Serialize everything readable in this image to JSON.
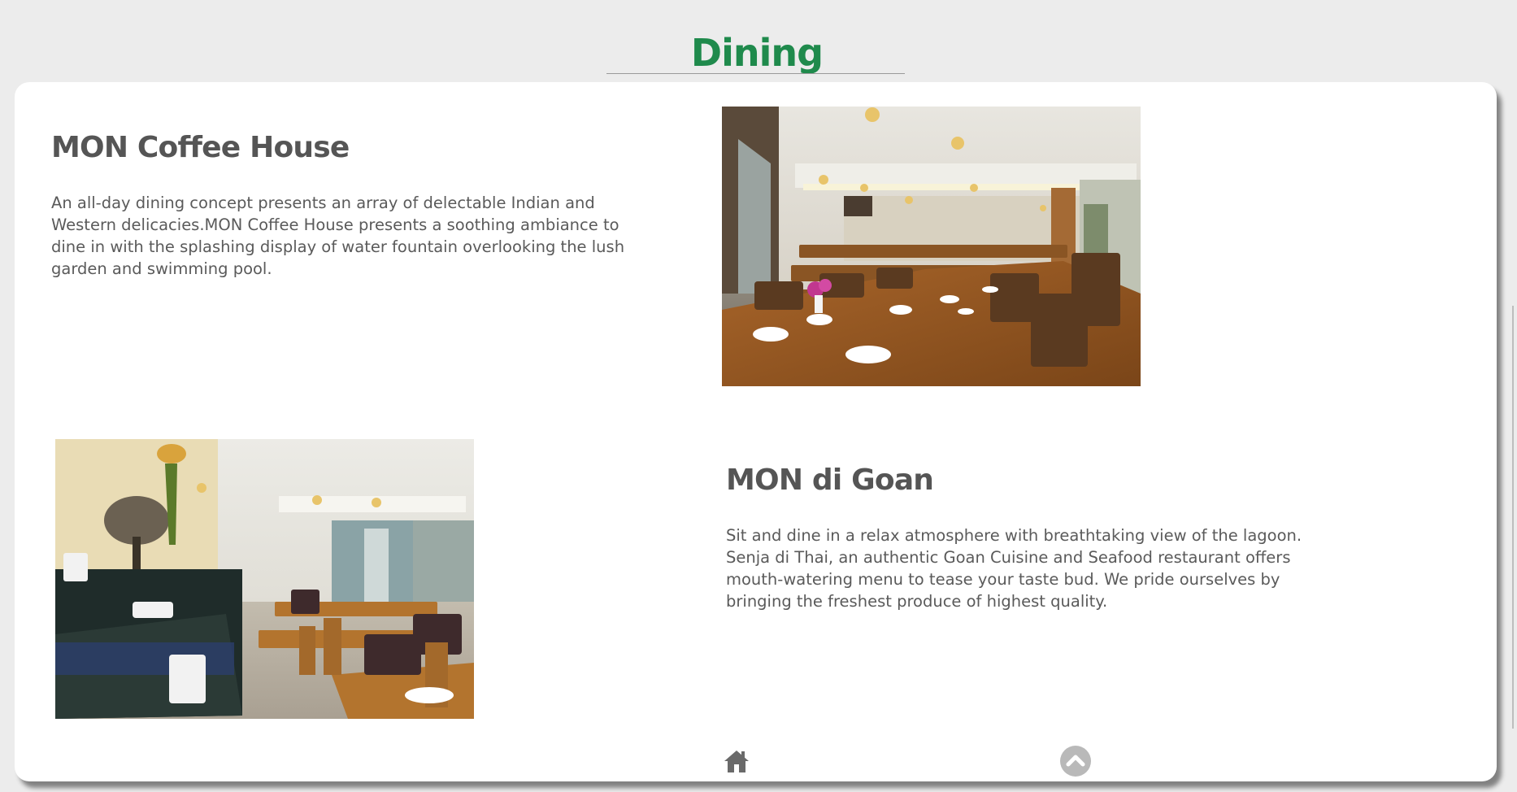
{
  "header": {
    "title": "Dining"
  },
  "sections": [
    {
      "heading": "MON Coffee House",
      "description": "An all-day dining concept presents an array of delectable Indian and Western delicacies.MON Coffee House presents a soothing ambiance to dine in with the splashing display of water fountain overlooking the lush garden and swimming pool.",
      "image": "restaurant-dining-hall-photo"
    },
    {
      "heading": "MON di Goan",
      "description": "Sit and dine in a relax atmosphere with breathtaking view of the lagoon. Senja di Thai, an authentic Goan Cuisine and Seafood restaurant offers mouth-watering menu to tease your taste bud. We pride ourselves by bringing the freshest produce of highest quality.",
      "image": "buffet-counter-dining-photo"
    }
  ],
  "footer": {
    "home_icon": "home-icon",
    "back_to_top_icon": "chevron-up-icon"
  },
  "colors": {
    "title": "#1f8a4c",
    "background": "#ececec",
    "card": "#ffffff",
    "text": "#5a5a5a"
  }
}
